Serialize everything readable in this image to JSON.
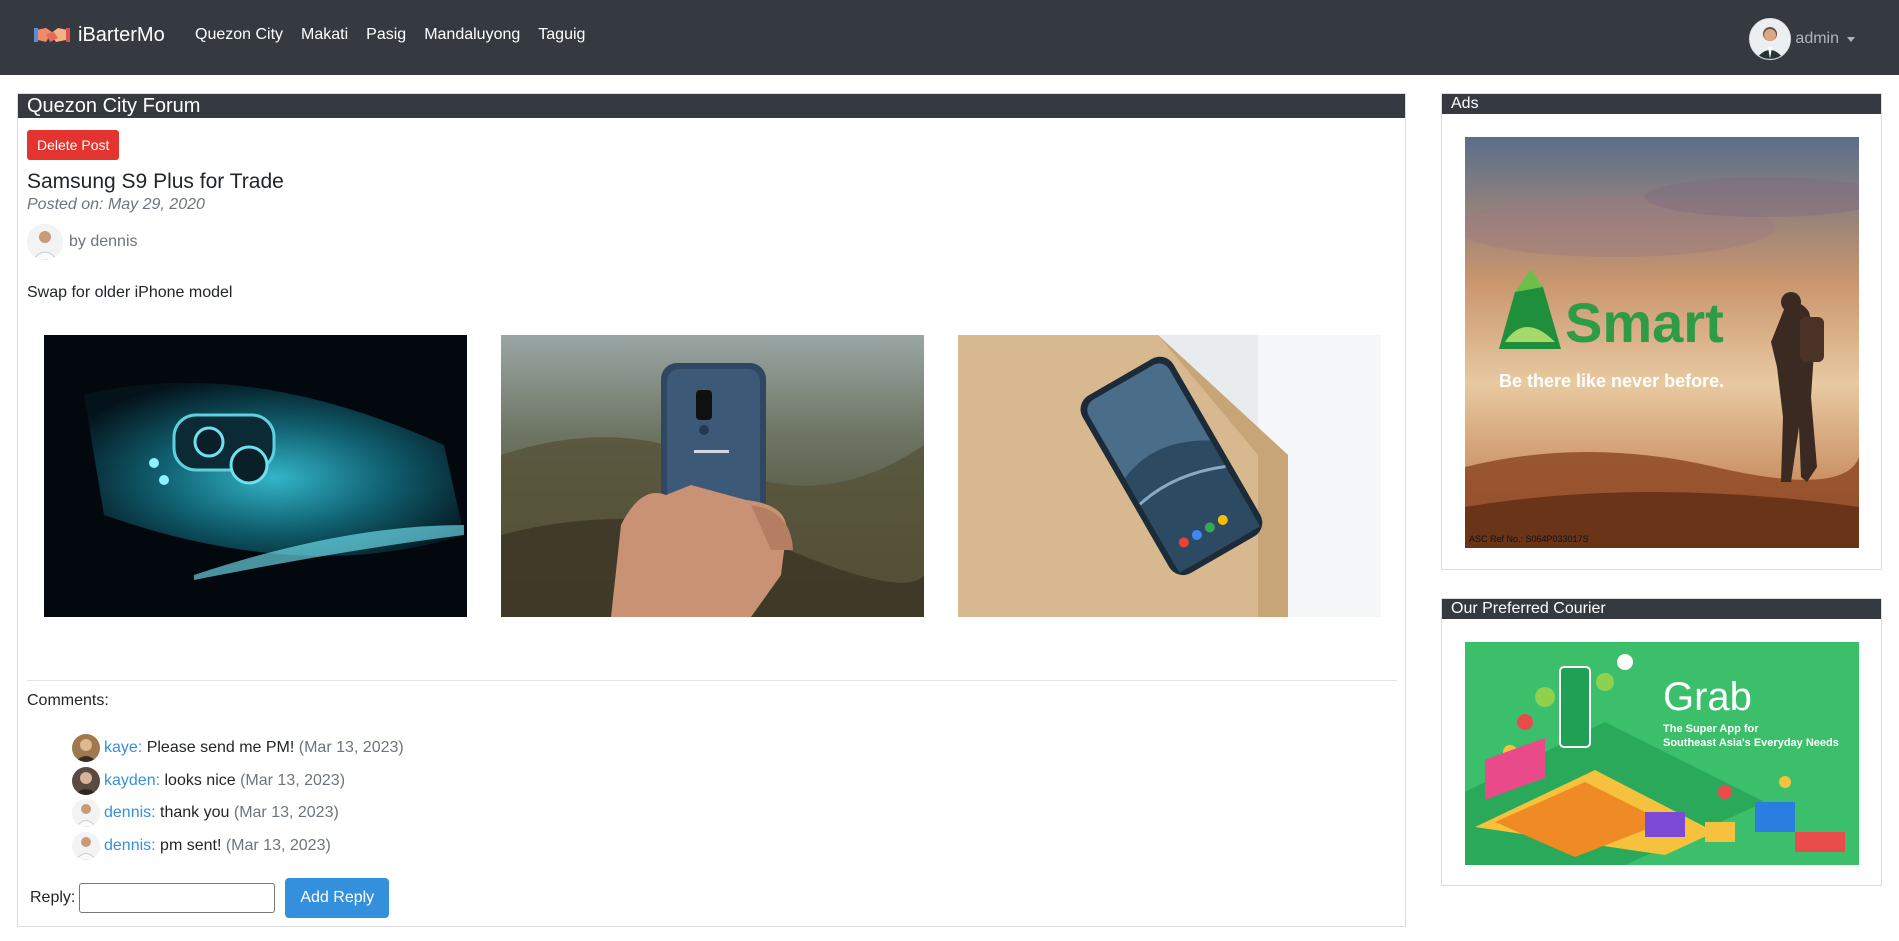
{
  "navbar": {
    "brand": "iBarterMo",
    "links": [
      "Quezon City",
      "Makati",
      "Pasig",
      "Mandaluyong",
      "Taguig"
    ],
    "user": "admin"
  },
  "forum": {
    "title": "Quezon City Forum",
    "delete_label": "Delete Post",
    "post": {
      "title": "Samsung S9 Plus for Trade",
      "date": "Posted on: May 29, 2020",
      "author": "by dennis",
      "body": "Swap for older iPhone model"
    },
    "comments_label": "Comments:",
    "comments": [
      {
        "user": "kaye:",
        "text": " Please send me PM!",
        "date": " (Mar 13, 2023)"
      },
      {
        "user": "kayden:",
        "text": " looks nice",
        "date": " (Mar 13, 2023)"
      },
      {
        "user": "dennis:",
        "text": " thank you",
        "date": " (Mar 13, 2023)"
      },
      {
        "user": "dennis:",
        "text": " pm sent!",
        "date": " (Mar 13, 2023)"
      }
    ],
    "reply_label": "Reply:",
    "reply_value": "",
    "add_reply_label": "Add Reply"
  },
  "sidebar": {
    "ads_title": "Ads",
    "ad": {
      "brand": "Smart",
      "tagline": "Be there like never before.",
      "ref": "ASC Ref No.: S064P033017S"
    },
    "courier_title": "Our Preferred Courier",
    "courier": {
      "brand": "Grab",
      "tagline_line1": "The Super App for",
      "tagline_line2": "Southeast Asia's Everyday Needs"
    }
  },
  "colors": {
    "navbar": "#343a40",
    "danger": "#e3342f",
    "primary": "#3490dc",
    "smart_green": "#2e9b45",
    "grab_green": "#3bbf6a"
  },
  "icons": [
    "handshake-logo-icon",
    "user-avatar-icon",
    "caret-down-icon",
    "smart-logo-icon"
  ]
}
